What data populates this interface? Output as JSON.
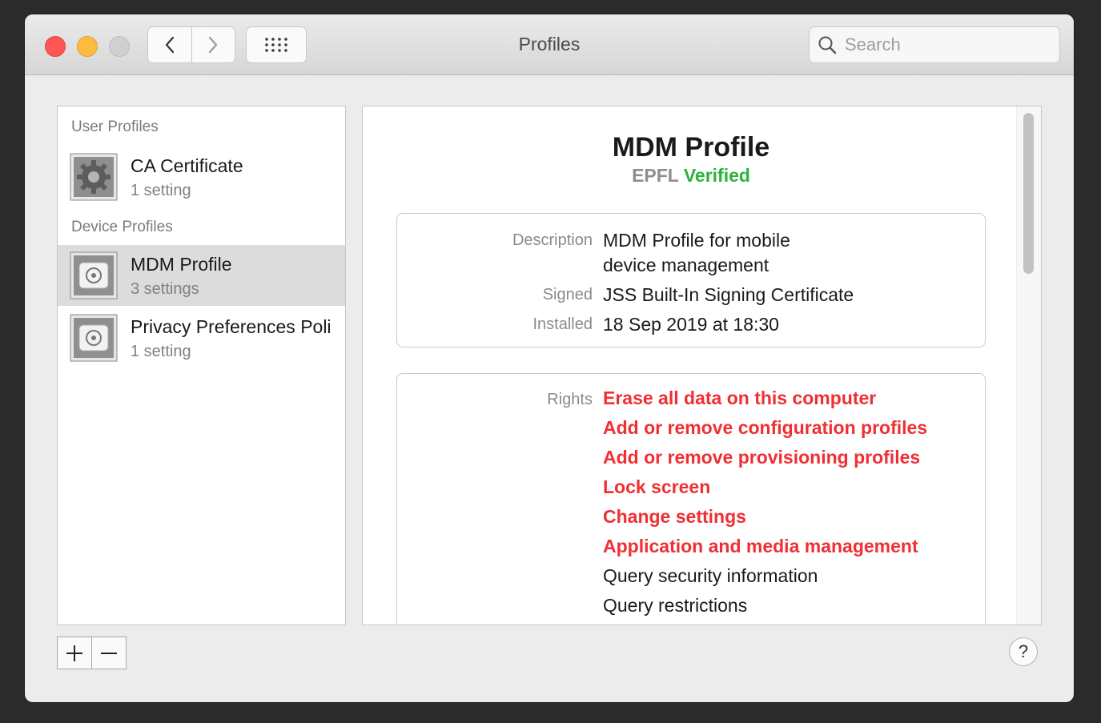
{
  "window": {
    "title": "Profiles",
    "search_placeholder": "Search"
  },
  "sidebar": {
    "user_header": "User Profiles",
    "device_header": "Device Profiles",
    "user_items": [
      {
        "name": "CA Certificate",
        "sub": "1 setting",
        "icon": "gear-certificate-icon"
      }
    ],
    "device_items": [
      {
        "name": "MDM Profile",
        "sub": "3 settings",
        "icon": "profile-icon",
        "selected": true
      },
      {
        "name": "Privacy Preferences Poli",
        "sub": "1 setting",
        "icon": "profile-icon",
        "selected": false
      }
    ]
  },
  "footer": {
    "add_label": "+",
    "remove_label": "−",
    "help_label": "?"
  },
  "detail": {
    "title": "MDM Profile",
    "org": "EPFL",
    "status": "Verified",
    "info": {
      "description_label": "Description",
      "description_line1": "MDM Profile for mobile",
      "description_line2": "device management",
      "signed_label": "Signed",
      "signed_value": "JSS Built-In Signing Certificate",
      "installed_label": "Installed",
      "installed_value": "18 Sep 2019 at 18:30"
    },
    "rights_label": "Rights",
    "rights": [
      {
        "text": "Erase all data on this computer",
        "warning": true
      },
      {
        "text": "Add or remove configuration profiles",
        "warning": true
      },
      {
        "text": "Add or remove provisioning profiles",
        "warning": true
      },
      {
        "text": "Lock screen",
        "warning": true
      },
      {
        "text": "Change settings",
        "warning": true
      },
      {
        "text": "Application and media management",
        "warning": true
      },
      {
        "text": "Query security information",
        "warning": false
      },
      {
        "text": "Query restrictions",
        "warning": false
      }
    ]
  },
  "colors": {
    "warning": "#ef2f34",
    "verified": "#2db33d",
    "close": "#fc5753",
    "minimize": "#fdbc40"
  }
}
